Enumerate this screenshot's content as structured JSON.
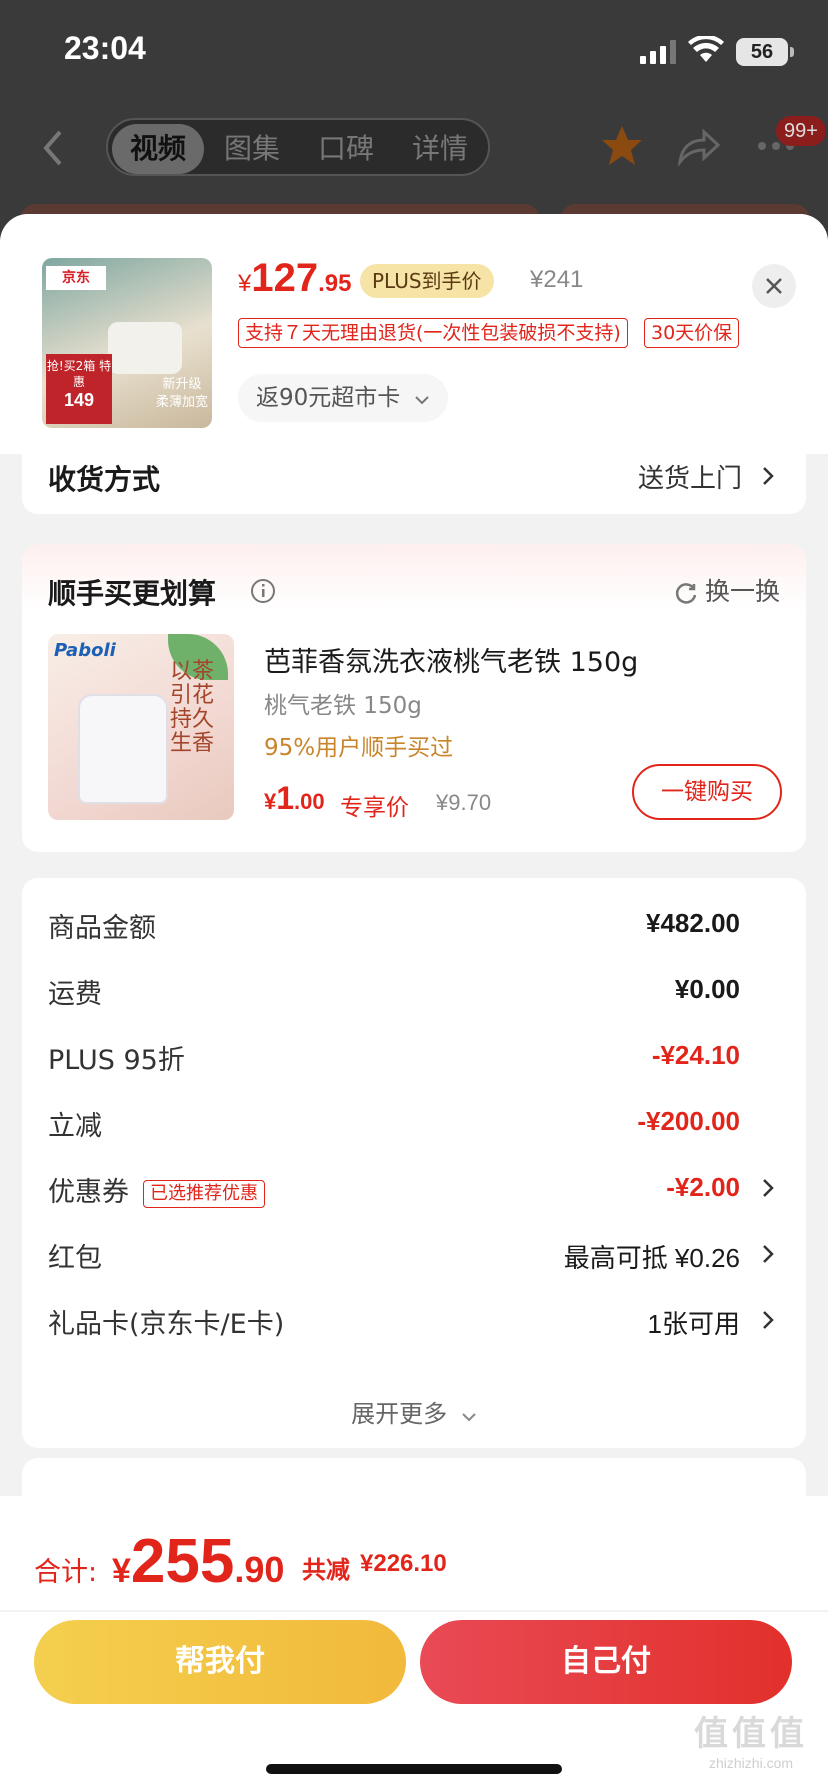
{
  "status_bar": {
    "time": "23:04",
    "battery": "56"
  },
  "top_nav": {
    "tabs": [
      {
        "label": "视频",
        "active": true
      },
      {
        "label": "图集",
        "active": false
      },
      {
        "label": "口碑",
        "active": false
      },
      {
        "label": "详情",
        "active": false
      }
    ],
    "message_badge": "99+"
  },
  "product": {
    "image_brand": "京东",
    "image_promo": "抢!买2箱 特惠",
    "image_price": "149",
    "image_caption": "新升级 柔薄加宽",
    "price_currency": "¥",
    "price_integer": "127",
    "price_decimal": ".95",
    "plus_tag": "PLUS到手价",
    "original_price": "¥241",
    "service_tags": [
      "支持７天无理由退货(一次性包装破损不支持)",
      "30天价保"
    ],
    "cashback": "返90元超市卡"
  },
  "delivery": {
    "label": "收货方式",
    "value": "送货上门"
  },
  "addon": {
    "title": "顺手买更划算",
    "swap_label": "换一换",
    "image_brand": "Paboli",
    "image_slogan": "以茶引花 持久生香",
    "name": "芭菲香氛洗衣液桃气老铁 150g",
    "spec": "桃气老铁 150g",
    "buyers": "95%用户顺手买过",
    "price_currency": "¥",
    "price_integer": "1",
    "price_decimal": ".00",
    "exclusive_label": "专享价",
    "original_price": "¥9.70",
    "buy_button": "一键购买"
  },
  "summary": {
    "rows": [
      {
        "label": "商品金额",
        "value": "¥482.00"
      },
      {
        "label": "运费",
        "value": "¥0.00"
      },
      {
        "label": "PLUS 95折",
        "value": "-¥24.10"
      },
      {
        "label": "立减",
        "value": "-¥200.00"
      },
      {
        "label": "优惠券",
        "tag": "已选推荐优惠",
        "value": "-¥2.00"
      },
      {
        "label": "红包",
        "value": "最高可抵 ¥0.26"
      },
      {
        "label": "礼品卡(京东卡/E卡)",
        "value": "1张可用"
      }
    ],
    "expand_label": "展开更多"
  },
  "footer": {
    "total_label": "合计:",
    "total_currency": "¥",
    "total_integer": "255",
    "total_decimal": ".90",
    "saved_label": "共减",
    "saved_amount": "¥226.10",
    "help_pay_button": "帮我付",
    "self_pay_button": "自己付"
  },
  "watermark": {
    "mark": "值值值",
    "site": "zhizhizhi.com"
  },
  "colors": {
    "accent_red": "#e1251b",
    "gold": "#f3c443",
    "plus_gold": "#f6e3a6"
  }
}
